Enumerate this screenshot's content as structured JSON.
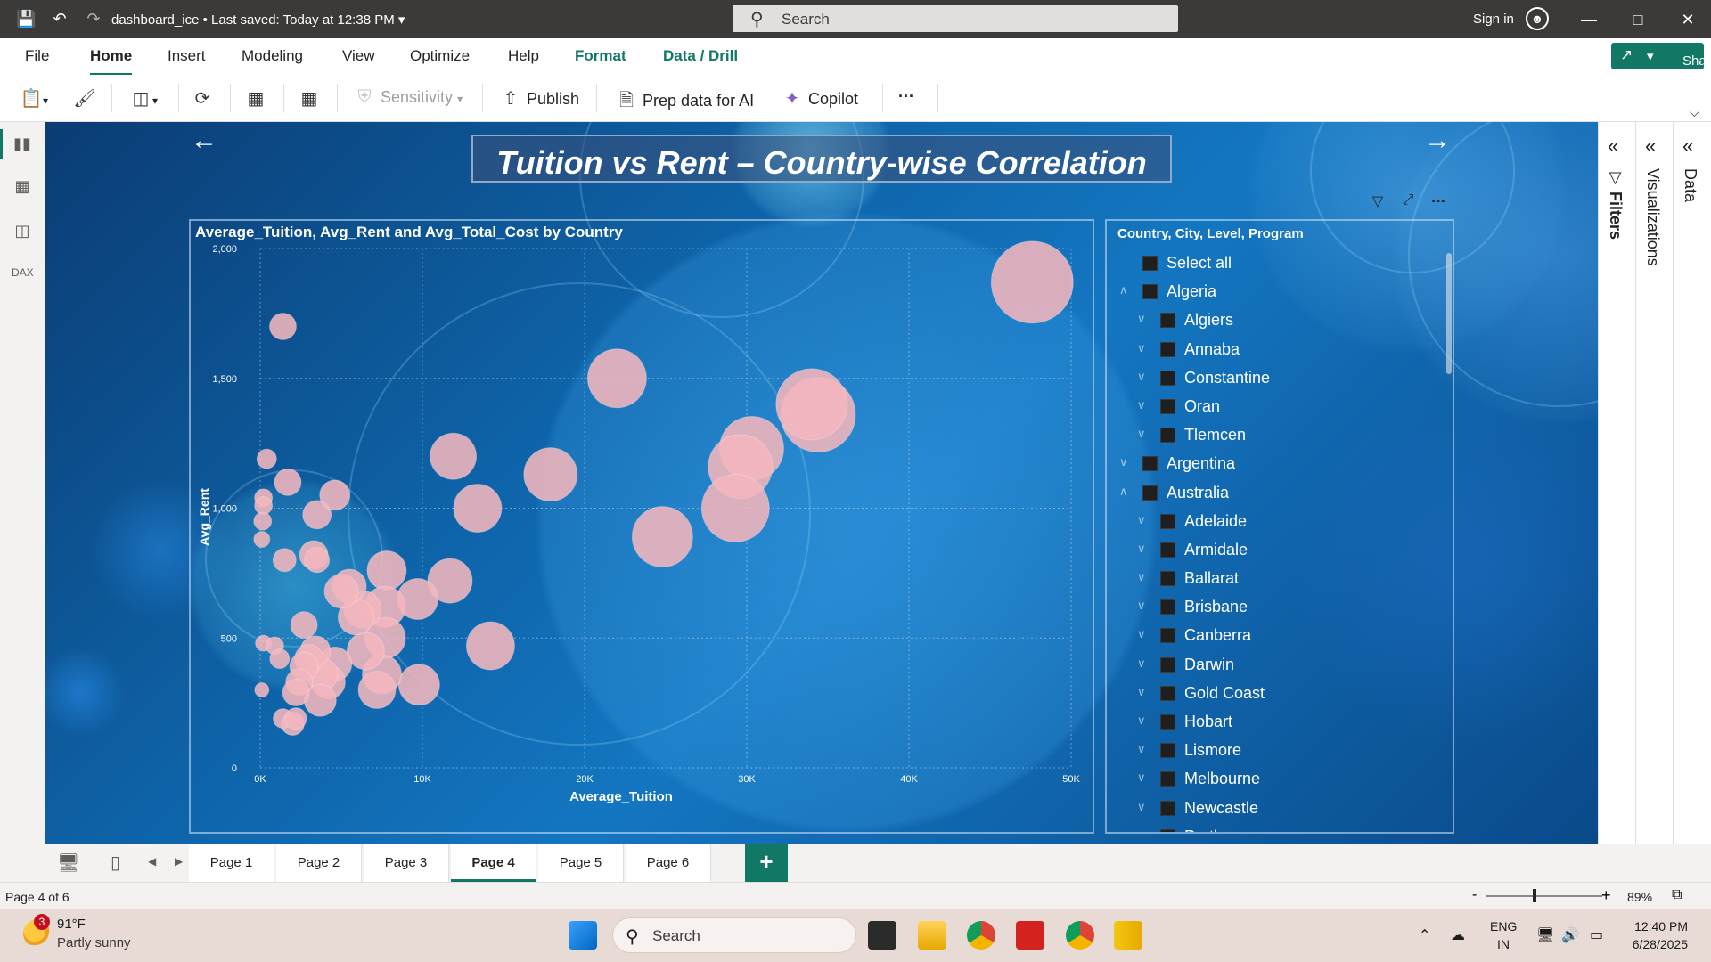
{
  "titlebar": {
    "doc_title": "dashboard_ice",
    "saved_status": "Last saved: Today at 12:38 PM",
    "search_placeholder": "Search",
    "sign_in": "Sign in"
  },
  "ribbon": {
    "tabs": [
      {
        "label": "File"
      },
      {
        "label": "Home"
      },
      {
        "label": "Insert"
      },
      {
        "label": "Modeling"
      },
      {
        "label": "View"
      },
      {
        "label": "Optimize"
      },
      {
        "label": "Help"
      },
      {
        "label": "Format"
      },
      {
        "label": "Data / Drill"
      }
    ],
    "active_tab": "Home",
    "share_label": "Share"
  },
  "toolbar": {
    "sensitivity_label": "Sensitivity",
    "publish_label": "Publish",
    "prep_label": "Prep data for AI",
    "copilot_label": "Copilot",
    "more_label": "···"
  },
  "report": {
    "page_title": "Tuition vs Rent – Country-wise Correlation"
  },
  "chart_data": {
    "type": "scatter",
    "title": "Average_Tuition, Avg_Rent and Avg_Total_Cost by Country",
    "xlabel": "Average_Tuition",
    "ylabel": "Avg_Rent",
    "xlim": [
      0,
      50000
    ],
    "ylim": [
      0,
      2000
    ],
    "x_ticks": [
      "0K",
      "10K",
      "20K",
      "30K",
      "40K",
      "50K"
    ],
    "y_ticks": [
      "0",
      "500",
      "1,000",
      "1,500",
      "2,000"
    ],
    "grid": true,
    "bubble_color": "#f4b6bd",
    "points": [
      {
        "x": 47600,
        "y": 1870,
        "size": 46
      },
      {
        "x": 34400,
        "y": 1360,
        "size": 42
      },
      {
        "x": 34000,
        "y": 1400,
        "size": 40
      },
      {
        "x": 22000,
        "y": 1500,
        "size": 33
      },
      {
        "x": 30300,
        "y": 1230,
        "size": 36
      },
      {
        "x": 29600,
        "y": 1160,
        "size": 36
      },
      {
        "x": 29300,
        "y": 1000,
        "size": 38
      },
      {
        "x": 24800,
        "y": 890,
        "size": 34
      },
      {
        "x": 17900,
        "y": 1130,
        "size": 30
      },
      {
        "x": 11900,
        "y": 1200,
        "size": 26
      },
      {
        "x": 13400,
        "y": 1000,
        "size": 27
      },
      {
        "x": 14200,
        "y": 470,
        "size": 27
      },
      {
        "x": 11700,
        "y": 720,
        "size": 25
      },
      {
        "x": 9700,
        "y": 650,
        "size": 23
      },
      {
        "x": 9800,
        "y": 320,
        "size": 23
      },
      {
        "x": 7800,
        "y": 760,
        "size": 22
      },
      {
        "x": 7700,
        "y": 620,
        "size": 23
      },
      {
        "x": 7700,
        "y": 500,
        "size": 23
      },
      {
        "x": 7500,
        "y": 360,
        "size": 22
      },
      {
        "x": 7200,
        "y": 300,
        "size": 21
      },
      {
        "x": 6300,
        "y": 610,
        "size": 21
      },
      {
        "x": 6500,
        "y": 450,
        "size": 21
      },
      {
        "x": 5900,
        "y": 580,
        "size": 20
      },
      {
        "x": 5500,
        "y": 700,
        "size": 19
      },
      {
        "x": 5000,
        "y": 680,
        "size": 19
      },
      {
        "x": 4600,
        "y": 400,
        "size": 19
      },
      {
        "x": 4200,
        "y": 330,
        "size": 19
      },
      {
        "x": 3800,
        "y": 360,
        "size": 18
      },
      {
        "x": 3700,
        "y": 260,
        "size": 18
      },
      {
        "x": 3400,
        "y": 450,
        "size": 17
      },
      {
        "x": 3000,
        "y": 420,
        "size": 16
      },
      {
        "x": 2700,
        "y": 390,
        "size": 16
      },
      {
        "x": 2400,
        "y": 330,
        "size": 15
      },
      {
        "x": 2200,
        "y": 290,
        "size": 15
      },
      {
        "x": 2000,
        "y": 170,
        "size": 13
      },
      {
        "x": 2700,
        "y": 550,
        "size": 15
      },
      {
        "x": 3300,
        "y": 820,
        "size": 16
      },
      {
        "x": 3500,
        "y": 800,
        "size": 14
      },
      {
        "x": 3500,
        "y": 975,
        "size": 16
      },
      {
        "x": 4600,
        "y": 1050,
        "size": 17
      },
      {
        "x": 1700,
        "y": 1100,
        "size": 15
      },
      {
        "x": 1500,
        "y": 800,
        "size": 13
      },
      {
        "x": 1400,
        "y": 1700,
        "size": 15
      },
      {
        "x": 400,
        "y": 1190,
        "size": 11
      },
      {
        "x": 200,
        "y": 1040,
        "size": 10
      },
      {
        "x": 200,
        "y": 1010,
        "size": 10
      },
      {
        "x": 150,
        "y": 950,
        "size": 10
      },
      {
        "x": 100,
        "y": 880,
        "size": 9
      },
      {
        "x": 200,
        "y": 480,
        "size": 9
      },
      {
        "x": 900,
        "y": 470,
        "size": 10
      },
      {
        "x": 1200,
        "y": 420,
        "size": 11
      },
      {
        "x": 100,
        "y": 300,
        "size": 8
      },
      {
        "x": 1400,
        "y": 190,
        "size": 11
      },
      {
        "x": 2200,
        "y": 190,
        "size": 12
      }
    ]
  },
  "slicer": {
    "title": "Country, City, Level, Program",
    "items": [
      {
        "label": "Select all",
        "level": 0,
        "chev": ""
      },
      {
        "label": "Algeria",
        "level": 0,
        "chev": "up"
      },
      {
        "label": "Algiers",
        "level": 1,
        "chev": "down"
      },
      {
        "label": "Annaba",
        "level": 1,
        "chev": "down"
      },
      {
        "label": "Constantine",
        "level": 1,
        "chev": "down"
      },
      {
        "label": "Oran",
        "level": 1,
        "chev": "down"
      },
      {
        "label": "Tlemcen",
        "level": 1,
        "chev": "down"
      },
      {
        "label": "Argentina",
        "level": 0,
        "chev": "down"
      },
      {
        "label": "Australia",
        "level": 0,
        "chev": "up"
      },
      {
        "label": "Adelaide",
        "level": 1,
        "chev": "down"
      },
      {
        "label": "Armidale",
        "level": 1,
        "chev": "down"
      },
      {
        "label": "Ballarat",
        "level": 1,
        "chev": "down"
      },
      {
        "label": "Brisbane",
        "level": 1,
        "chev": "down"
      },
      {
        "label": "Canberra",
        "level": 1,
        "chev": "down"
      },
      {
        "label": "Darwin",
        "level": 1,
        "chev": "down"
      },
      {
        "label": "Gold Coast",
        "level": 1,
        "chev": "down"
      },
      {
        "label": "Hobart",
        "level": 1,
        "chev": "down"
      },
      {
        "label": "Lismore",
        "level": 1,
        "chev": "down"
      },
      {
        "label": "Melbourne",
        "level": 1,
        "chev": "down"
      },
      {
        "label": "Newcastle",
        "level": 1,
        "chev": "down"
      },
      {
        "label": "Perth",
        "level": 1,
        "chev": "down"
      }
    ]
  },
  "panes": {
    "filters": "Filters",
    "visualizations": "Visualizations",
    "data": "Data"
  },
  "pages": {
    "tabs": [
      {
        "label": "Page 1"
      },
      {
        "label": "Page 2"
      },
      {
        "label": "Page 3"
      },
      {
        "label": "Page 4"
      },
      {
        "label": "Page 5"
      },
      {
        "label": "Page 6"
      }
    ],
    "active": "Page 4",
    "add_label": "+"
  },
  "status": {
    "page_indicator": "Page 4 of 6",
    "zoom": "89%",
    "zoom_minus": "-",
    "zoom_plus": "+"
  },
  "taskbar": {
    "weather_temp": "91°F",
    "weather_desc": "Partly sunny",
    "weather_badge": "3",
    "search_placeholder": "Search",
    "lang_1": "ENG",
    "lang_2": "IN",
    "time": "12:40 PM",
    "date": "6/28/2025"
  }
}
